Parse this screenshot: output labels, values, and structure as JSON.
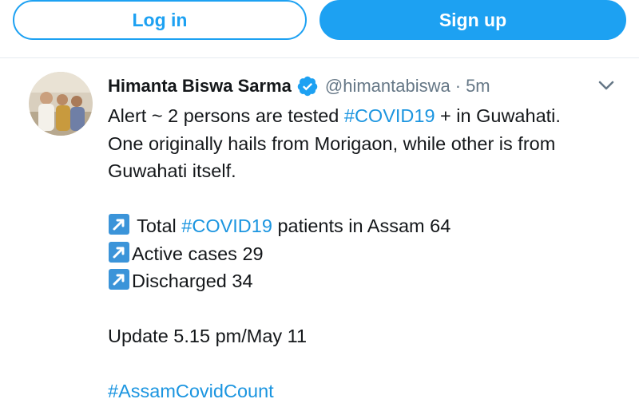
{
  "auth": {
    "login_label": "Log in",
    "signup_label": "Sign up"
  },
  "tweet": {
    "author_name": "Himanta Biswa Sarma",
    "handle": "@himantabiswa",
    "separator": "·",
    "time": "5m",
    "verified_icon": "verified-badge-icon",
    "menu_icon": "chevron-down-icon",
    "line1_pre": "Alert ~ 2 persons are tested ",
    "line1_hashtag": "#COVID19",
    "line1_post": " + in Guwahati.",
    "line2": "One originally hails from Morigaon, while other is from",
    "line3": "Guwahati itself.",
    "stat1_pre": " Total ",
    "stat1_hashtag": "#COVID19",
    "stat1_post": " patients in Assam 64",
    "stat2": "Active cases 29",
    "stat3": "Discharged 34",
    "update": "Update 5.15 pm/May 11",
    "footer_hashtag": "#AssamCovidCount"
  },
  "colors": {
    "accent": "#1da1f2",
    "hashtag": "#1b95e0",
    "muted": "#657786",
    "arrow_box": "#3b94d9"
  }
}
